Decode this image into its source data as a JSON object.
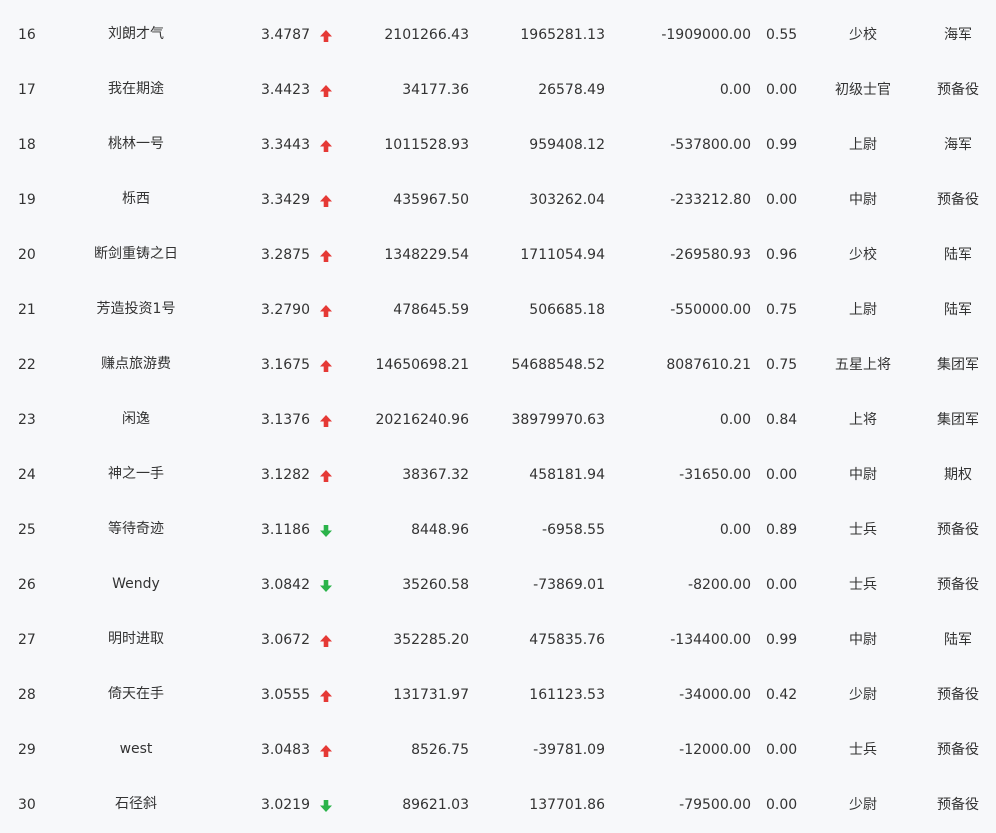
{
  "colors": {
    "up": "#e53935",
    "down": "#2bb34a",
    "text": "#333333",
    "background": "#f7f8fa"
  },
  "rows": [
    {
      "rank": "16",
      "name": "刘朗才气",
      "score": "3.4787",
      "trend": "up",
      "v1": "2101266.43",
      "v2": "1965281.13",
      "v3": "-1909000.00",
      "ratio": "0.55",
      "rank_title": "少校",
      "branch": "海军"
    },
    {
      "rank": "17",
      "name": "我在期途",
      "score": "3.4423",
      "trend": "up",
      "v1": "34177.36",
      "v2": "26578.49",
      "v3": "0.00",
      "ratio": "0.00",
      "rank_title": "初级士官",
      "branch": "预备役"
    },
    {
      "rank": "18",
      "name": "桃林一号",
      "score": "3.3443",
      "trend": "up",
      "v1": "1011528.93",
      "v2": "959408.12",
      "v3": "-537800.00",
      "ratio": "0.99",
      "rank_title": "上尉",
      "branch": "海军"
    },
    {
      "rank": "19",
      "name": "栎西",
      "score": "3.3429",
      "trend": "up",
      "v1": "435967.50",
      "v2": "303262.04",
      "v3": "-233212.80",
      "ratio": "0.00",
      "rank_title": "中尉",
      "branch": "预备役"
    },
    {
      "rank": "20",
      "name": "断剑重铸之日",
      "score": "3.2875",
      "trend": "up",
      "v1": "1348229.54",
      "v2": "1711054.94",
      "v3": "-269580.93",
      "ratio": "0.96",
      "rank_title": "少校",
      "branch": "陆军"
    },
    {
      "rank": "21",
      "name": "芳造投资1号",
      "score": "3.2790",
      "trend": "up",
      "v1": "478645.59",
      "v2": "506685.18",
      "v3": "-550000.00",
      "ratio": "0.75",
      "rank_title": "上尉",
      "branch": "陆军"
    },
    {
      "rank": "22",
      "name": "赚点旅游费",
      "score": "3.1675",
      "trend": "up",
      "v1": "14650698.21",
      "v2": "54688548.52",
      "v3": "8087610.21",
      "ratio": "0.75",
      "rank_title": "五星上将",
      "branch": "集团军"
    },
    {
      "rank": "23",
      "name": "闲逸",
      "score": "3.1376",
      "trend": "up",
      "v1": "20216240.96",
      "v2": "38979970.63",
      "v3": "0.00",
      "ratio": "0.84",
      "rank_title": "上将",
      "branch": "集团军"
    },
    {
      "rank": "24",
      "name": "神之一手",
      "score": "3.1282",
      "trend": "up",
      "v1": "38367.32",
      "v2": "458181.94",
      "v3": "-31650.00",
      "ratio": "0.00",
      "rank_title": "中尉",
      "branch": "期权"
    },
    {
      "rank": "25",
      "name": "等待奇迹",
      "score": "3.1186",
      "trend": "down",
      "v1": "8448.96",
      "v2": "-6958.55",
      "v3": "0.00",
      "ratio": "0.89",
      "rank_title": "士兵",
      "branch": "预备役"
    },
    {
      "rank": "26",
      "name": "Wendy",
      "score": "3.0842",
      "trend": "down",
      "v1": "35260.58",
      "v2": "-73869.01",
      "v3": "-8200.00",
      "ratio": "0.00",
      "rank_title": "士兵",
      "branch": "预备役"
    },
    {
      "rank": "27",
      "name": "明时进取",
      "score": "3.0672",
      "trend": "up",
      "v1": "352285.20",
      "v2": "475835.76",
      "v3": "-134400.00",
      "ratio": "0.99",
      "rank_title": "中尉",
      "branch": "陆军"
    },
    {
      "rank": "28",
      "name": "倚天在手",
      "score": "3.0555",
      "trend": "up",
      "v1": "131731.97",
      "v2": "161123.53",
      "v3": "-34000.00",
      "ratio": "0.42",
      "rank_title": "少尉",
      "branch": "预备役"
    },
    {
      "rank": "29",
      "name": "west",
      "score": "3.0483",
      "trend": "up",
      "v1": "8526.75",
      "v2": "-39781.09",
      "v3": "-12000.00",
      "ratio": "0.00",
      "rank_title": "士兵",
      "branch": "预备役"
    },
    {
      "rank": "30",
      "name": "石径斜",
      "score": "3.0219",
      "trend": "down",
      "v1": "89621.03",
      "v2": "137701.86",
      "v3": "-79500.00",
      "ratio": "0.00",
      "rank_title": "少尉",
      "branch": "预备役"
    }
  ]
}
